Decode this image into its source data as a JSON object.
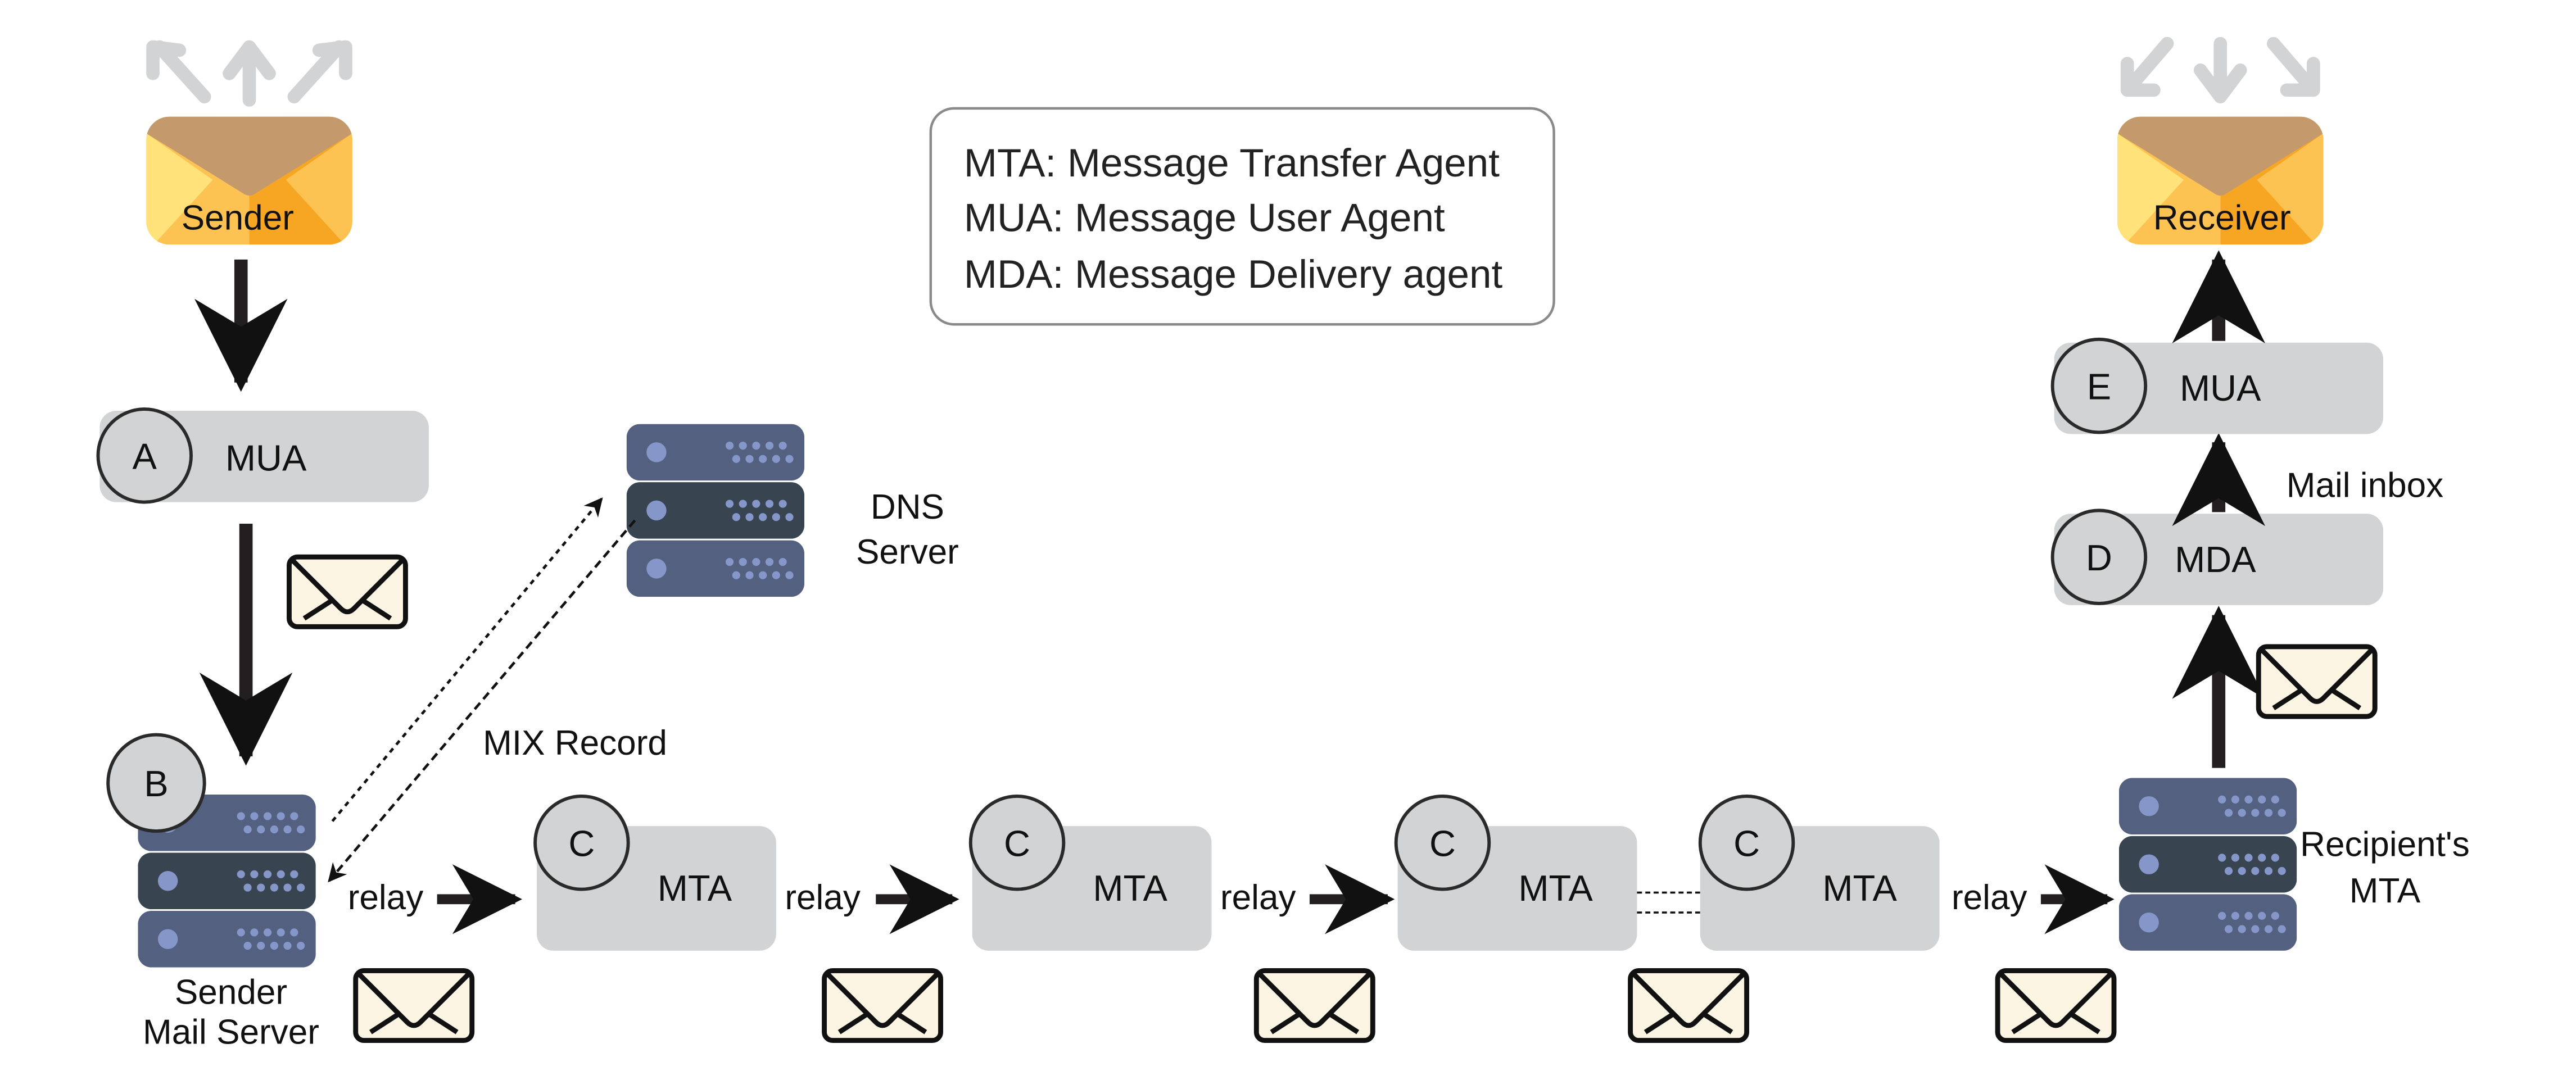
{
  "legend": {
    "lines": [
      "MTA: Message Transfer Agent",
      "MUA: Message User Agent",
      "MDA: Message Delivery agent"
    ]
  },
  "sender": {
    "label": "Sender"
  },
  "receiver": {
    "label": "Receiver"
  },
  "nodes": {
    "a": {
      "letter": "A",
      "label": "MUA"
    },
    "b": {
      "letter": "B",
      "label_line1": "Sender",
      "label_line2": "Mail Server"
    },
    "c": {
      "letter": "C",
      "label": "MTA"
    },
    "d": {
      "letter": "D",
      "label": "MDA"
    },
    "e": {
      "letter": "E",
      "label": "MUA"
    }
  },
  "dns": {
    "line1": "DNS",
    "line2": "Server"
  },
  "mix_record": "MIX Record",
  "relay": "relay",
  "recipient": {
    "line1": "Recipient's",
    "line2": "MTA"
  },
  "mail_inbox": "Mail inbox",
  "colors": {
    "server_light": "#54607f",
    "server_dark": "#38444f",
    "server_dots": "#8596c9",
    "pill": "#d1d3d4",
    "envelope_flap": "#c49a6c",
    "envelope_left": "#fcc353",
    "envelope_right": "#f7a624",
    "envelope_side": "#ffe27a",
    "letter_bg": "#fcf5e4",
    "fanout_arrows": "#d1d3d4"
  },
  "icons": [
    "mail-envelope-icon",
    "server-icon",
    "letter-icon",
    "arrow-icon"
  ]
}
